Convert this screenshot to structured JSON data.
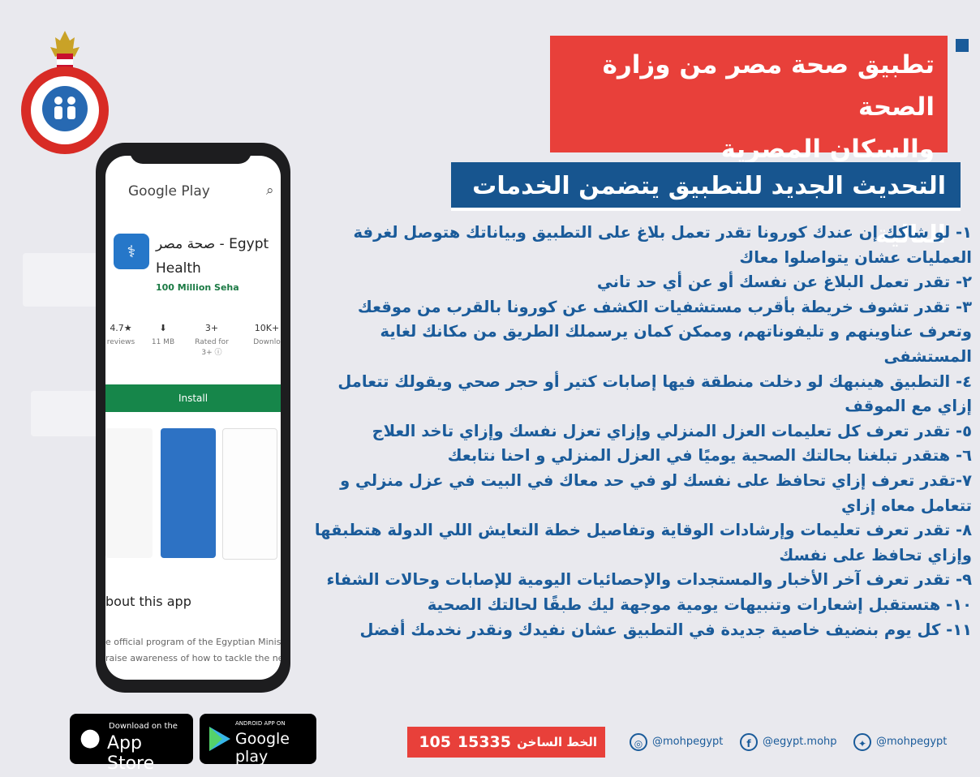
{
  "banner": {
    "title_line1": "تطبيق صحة مصر من وزارة الصحة",
    "title_line2": "والسكان المصرية"
  },
  "subtitle": "التحديث الجديد للتطبيق يتضمن الخدمات التالية",
  "items": [
    "١- لو شاكك إن عندك كورونا تقدر تعمل بلاغ على التطبيق وبياناتك هتوصل لغرفة العمليات عشان يتواصلوا معاك",
    "٢- تقدر تعمل البلاغ عن نفسك أو عن أي حد تاني",
    "٣- تقدر تشوف خريطة بأقرب مستشفيات الكشف عن كورونا بالقرب من موقعك وتعرف عناوينهم و تليفوناتهم، وممكن كمان يرسملك الطريق من مكانك لغاية المستشفى",
    "٤- التطبيق هينبهك لو دخلت منطقة فيها إصابات كتير أو حجر صحي ويقولك تتعامل إزاي مع الموقف",
    "٥- تقدر تعرف كل تعليمات العزل المنزلي وإزاي تعزل نفسك وإزاي تاخد العلاج",
    "٦- هتقدر تبلغنا بحالتك الصحية يوميًا في العزل المنزلي و احنا نتابعك",
    "٧-تقدر تعرف إزاي تحافظ على نفسك لو في حد معاك في البيت في عزل منزلي و تتعامل معاه إزاي",
    "٨- تقدر تعرف تعليمات وإرشادات الوقاية وتفاصيل خطة التعايش اللي الدولة هتطبقها وإزاي تحافظ على نفسك",
    "٩- تقدر تعرف آخر الأخبار والمستجدات والإحصائيات اليومية للإصابات وحالات الشفاء",
    "١٠- هتستقبل إشعارات وتنبيهات يومية موجهة ليك طبقًا لحالتك الصحية",
    "١١- كل يوم بنضيف خاصية جديدة في التطبيق عشان نفيدك ونقدر نخدمك أفضل"
  ],
  "phone": {
    "store_title": "Google Play",
    "app_name": "صحة مصر - Egypt Health",
    "developer": "100 Million Seha",
    "stats": [
      {
        "value": "4.7★",
        "label": "reviews"
      },
      {
        "value": "⬇",
        "label": "11 MB"
      },
      {
        "value": "3+",
        "label": "Rated for 3+ ⓘ"
      },
      {
        "value": "10K+",
        "label": "Downlo"
      }
    ],
    "install_label": "Install",
    "about_heading": "bout this app",
    "about_line1": "e official program of the Egyptian Ministry of He",
    "about_line2": "raise awareness of how to tackle the new coro"
  },
  "badges": {
    "appstore_small": "Download on the",
    "appstore_big": "App Store",
    "gplay_small": "ANDROID APP ON",
    "gplay_big": "Google play"
  },
  "hotline": {
    "label": "الخط الساخن",
    "number1": "15335",
    "number2": "105"
  },
  "social": {
    "instagram": "@mohpegypt",
    "facebook": "@egypt.mohp",
    "twitter": "@mohpegypt"
  },
  "colors": {
    "red": "#e8403a",
    "blue": "#17558f",
    "text_blue": "#1a5b9a",
    "green": "#16864a"
  }
}
